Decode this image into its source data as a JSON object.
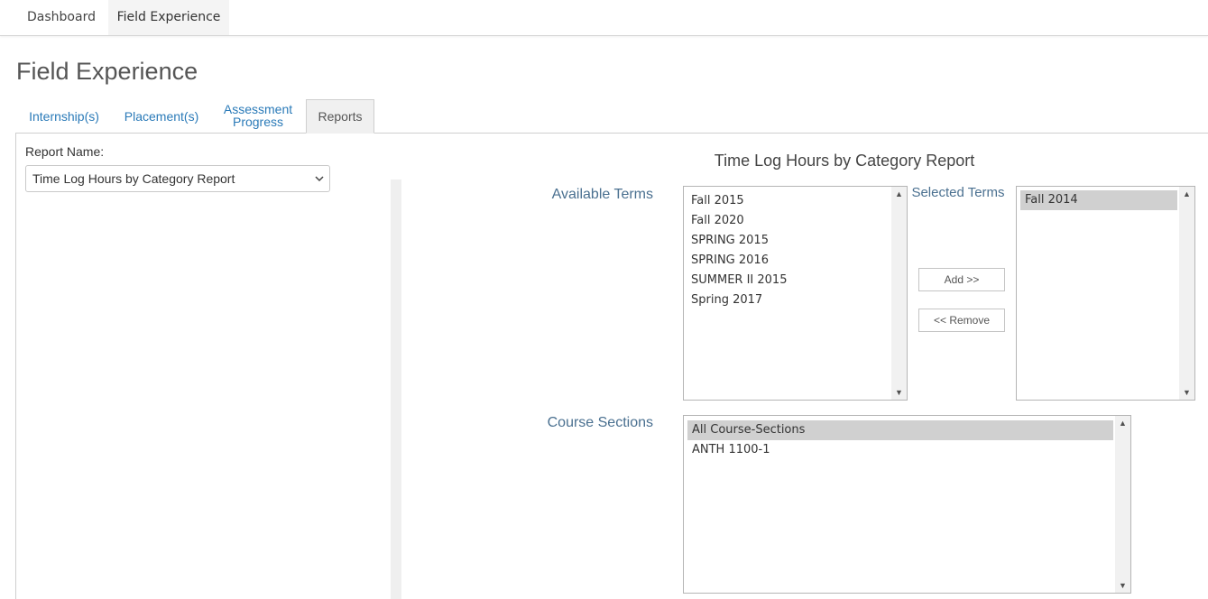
{
  "top_nav": {
    "tabs": [
      "Dashboard",
      "Field Experience"
    ],
    "active": "Field Experience"
  },
  "page_title": "Field Experience",
  "sub_tabs": {
    "internships": "Internship(s)",
    "placements": "Placement(s)",
    "assessment_line1": "Assessment",
    "assessment_line2": "Progress",
    "reports": "Reports",
    "active": "Reports"
  },
  "report": {
    "name_label": "Report Name:",
    "selected_value": "Time Log Hours by Category Report",
    "heading": "Time Log Hours by Category Report"
  },
  "terms": {
    "available_label": "Available Terms",
    "selected_label": "Selected Terms",
    "available": [
      "Fall 2015",
      "Fall 2020",
      "SPRING 2015",
      "SPRING 2016",
      "SUMMER II 2015",
      "Spring 2017"
    ],
    "selected": [
      "Fall 2014"
    ],
    "add_button": "Add >>",
    "remove_button": "<< Remove"
  },
  "course_sections": {
    "label": "Course Sections",
    "options": [
      "All Course-Sections",
      "ANTH 1100-1"
    ],
    "selected_option": "All Course-Sections"
  },
  "colors": {
    "link": "#2a7ab8",
    "label": "#4a7090",
    "selected_option": "#d0d0d0"
  },
  "icons": {
    "select": "chevron-down-icon",
    "scroll_up": "scroll-up-arrow-icon",
    "scroll_down": "scroll-down-arrow-icon"
  }
}
